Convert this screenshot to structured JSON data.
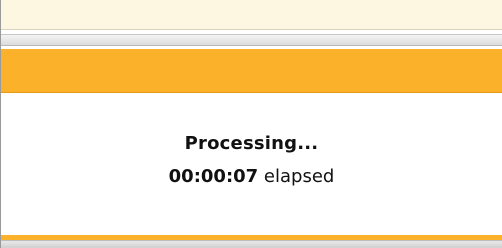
{
  "dialog": {
    "status_title": "Processing...",
    "elapsed_time": "00:00:07",
    "elapsed_suffix": " elapsed"
  },
  "colors": {
    "accent": "#fbb12a",
    "banner": "#fdf6e0",
    "text": "#111111"
  }
}
